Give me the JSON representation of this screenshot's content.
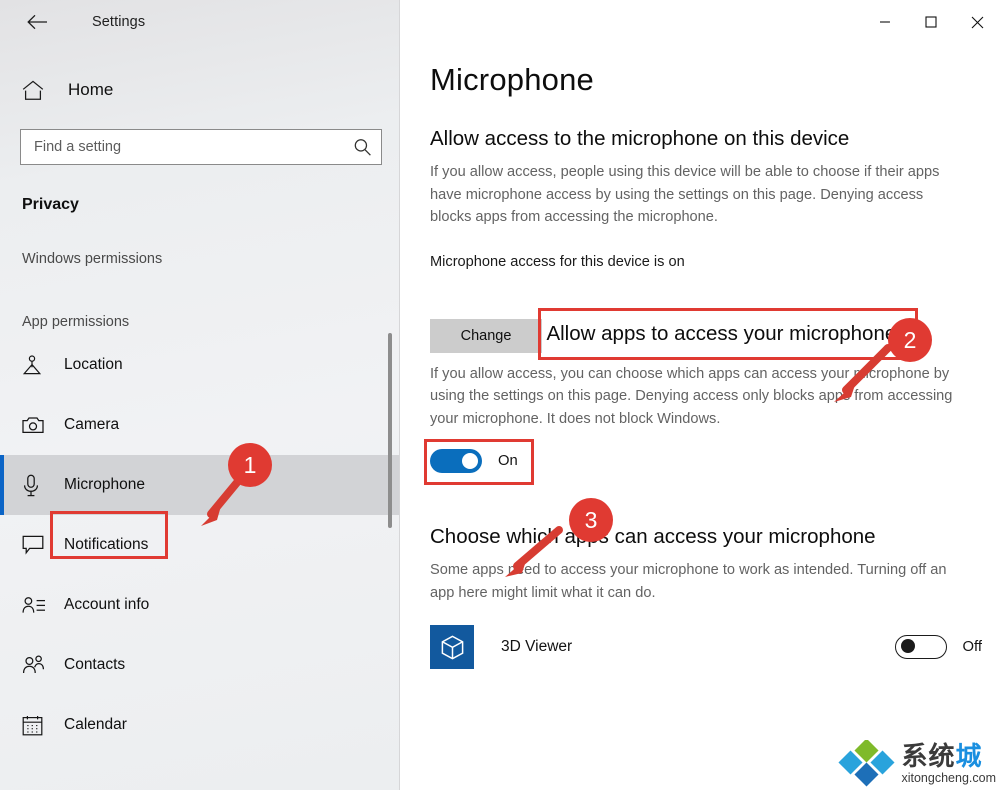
{
  "window": {
    "title": "Settings",
    "back_icon": "back-arrow-icon",
    "controls": {
      "minimize": "minimize-icon",
      "maximize": "maximize-icon",
      "close": "close-icon"
    }
  },
  "sidebar": {
    "home": {
      "label": "Home",
      "icon": "home-icon"
    },
    "search": {
      "placeholder": "Find a setting",
      "value": "",
      "icon": "search-icon"
    },
    "category": "Privacy",
    "groups": [
      {
        "label": "Windows permissions",
        "items": []
      },
      {
        "label": "App permissions",
        "items": [
          {
            "label": "Location",
            "icon": "location-icon",
            "selected": false
          },
          {
            "label": "Camera",
            "icon": "camera-icon",
            "selected": false
          },
          {
            "label": "Microphone",
            "icon": "microphone-icon",
            "selected": true
          },
          {
            "label": "Notifications",
            "icon": "notification-icon",
            "selected": false
          },
          {
            "label": "Account info",
            "icon": "account-info-icon",
            "selected": false
          },
          {
            "label": "Contacts",
            "icon": "contacts-icon",
            "selected": false
          },
          {
            "label": "Calendar",
            "icon": "calendar-icon",
            "selected": false
          }
        ]
      }
    ]
  },
  "main": {
    "page_title": "Microphone",
    "device_section": {
      "heading": "Allow access to the microphone on this device",
      "body": "If you allow access, people using this device will be able to choose if their apps have microphone access by using the settings on this page. Denying access blocks apps from accessing the microphone.",
      "status": "Microphone access for this device is on",
      "change_button": "Change"
    },
    "apps_section": {
      "heading": "Allow apps to access your microphone",
      "body": "If you allow access, you can choose which apps can access your microphone by using the settings on this page. Denying access only blocks apps from accessing your microphone. It does not block Windows.",
      "toggle_state": "On"
    },
    "choose_section": {
      "heading": "Choose which apps can access your microphone",
      "body": "Some apps need to access your microphone to work as intended. Turning off an app here might limit what it can do.",
      "apps": [
        {
          "name": "3D Viewer",
          "icon": "3d-viewer-icon",
          "toggle_state": "Off"
        }
      ]
    }
  },
  "annotations": {
    "callouts": [
      {
        "number": "1",
        "target": "sidebar-item-microphone"
      },
      {
        "number": "2",
        "target": "allow-apps-heading"
      },
      {
        "number": "3",
        "target": "allow-apps-toggle"
      }
    ],
    "accent_color": "#e03a32"
  },
  "watermark": {
    "cn_dark": "系统",
    "cn_blue": "城",
    "url": "xitongcheng.com"
  },
  "colors": {
    "accent_blue": "#0a6ebd",
    "selection_bar": "#0b64c6",
    "annotation_red": "#e03a32",
    "app_tile_blue": "#12599e"
  }
}
